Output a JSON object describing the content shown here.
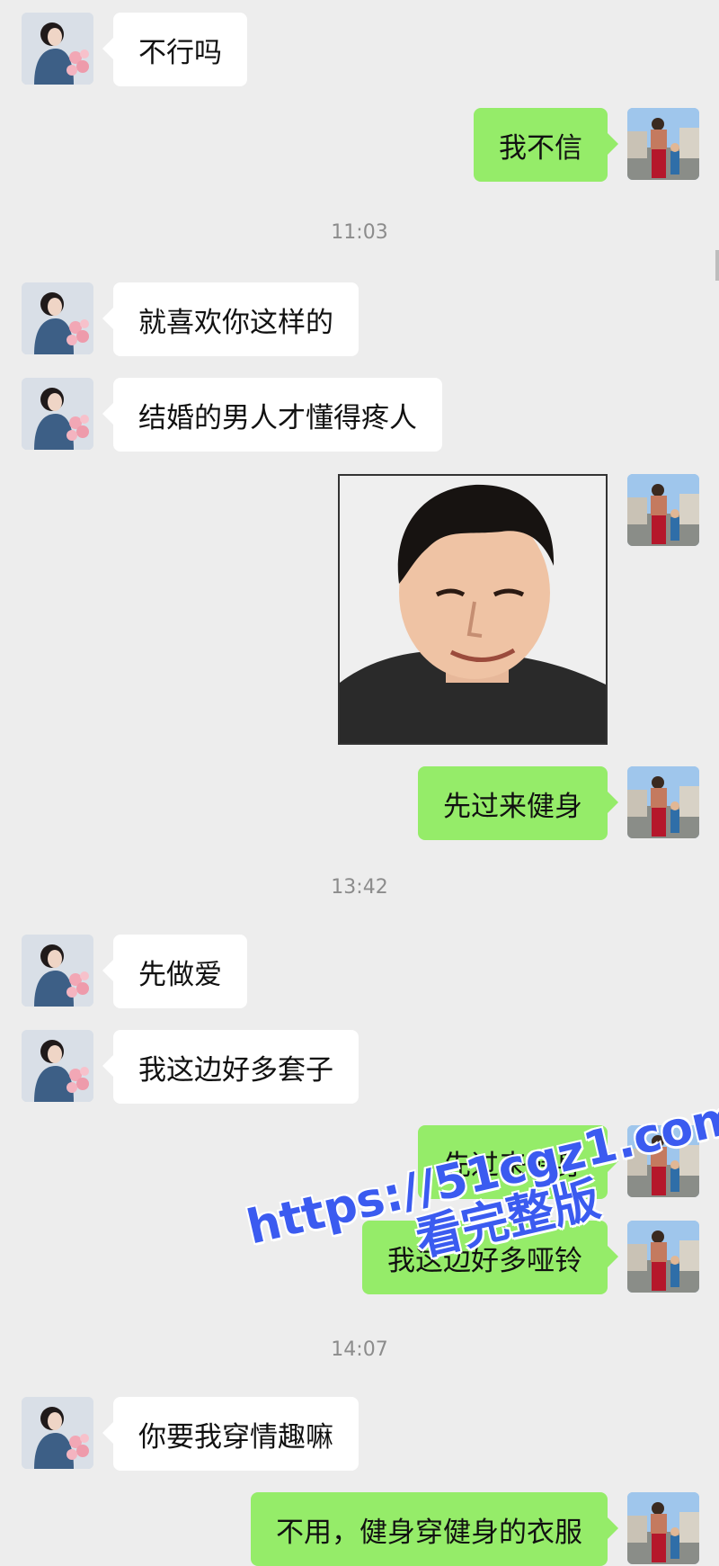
{
  "timestamps": [
    "11:03",
    "13:42",
    "14:07"
  ],
  "messages": [
    {
      "side": "in",
      "text": "不行吗"
    },
    {
      "side": "out",
      "text": "我不信"
    },
    {
      "side": "in",
      "text": "就喜欢你这样的"
    },
    {
      "side": "in",
      "text": "结婚的男人才懂得疼人"
    },
    {
      "side": "out",
      "text": "先过来健身"
    },
    {
      "side": "in",
      "text": "先做爱"
    },
    {
      "side": "in",
      "text": "我这边好多套子"
    },
    {
      "side": "out",
      "text": "先过来健身"
    },
    {
      "side": "out",
      "text": "我这边好多哑铃"
    },
    {
      "side": "in",
      "text": "你要我穿情趣嘛"
    },
    {
      "side": "out",
      "text": "不用，健身穿健身的衣服"
    }
  ],
  "watermark": {
    "line1": "https://51cgz1.com",
    "line2": "看完整版"
  },
  "icons": {
    "contact_avatar": "girl-with-flowers-avatar",
    "self_avatar": "man-street-photo-avatar",
    "sticker": "smiling-man-photo-sticker"
  },
  "colors": {
    "background": "#ededed",
    "incoming": "#ffffff",
    "outgoing": "#95ec69",
    "watermark": "#3b5bf0"
  }
}
